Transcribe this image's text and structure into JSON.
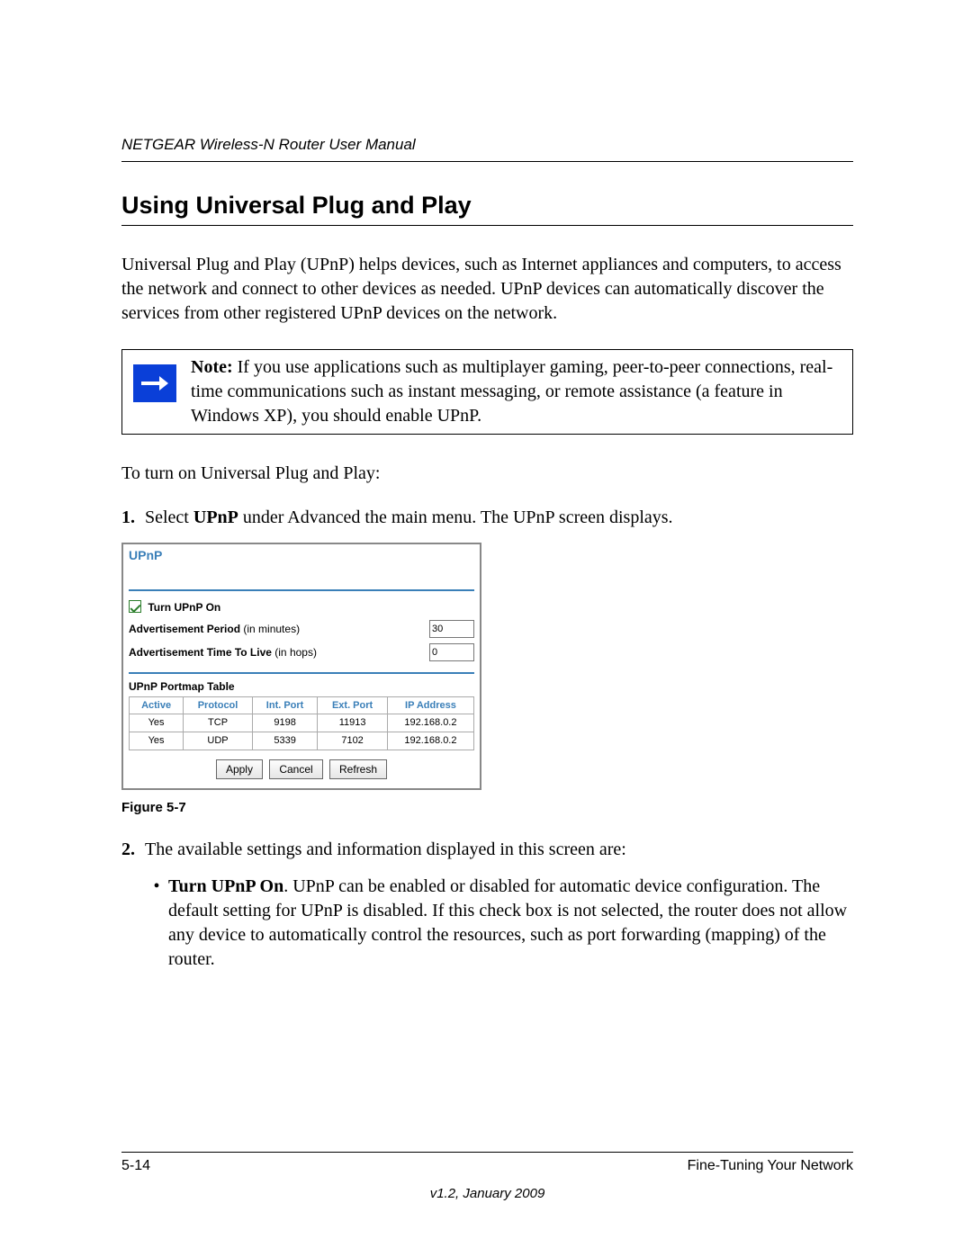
{
  "header": {
    "running_title": "NETGEAR Wireless-N Router User Manual"
  },
  "section": {
    "title": "Using Universal Plug and Play",
    "intro": "Universal Plug and Play (UPnP) helps devices, such as Internet appliances and computers, to access the network and connect to other devices as needed. UPnP devices can automatically discover the services from other registered UPnP devices on the network."
  },
  "note": {
    "label": "Note:",
    "text": " If you use applications such as multiplayer gaming, peer-to-peer connections, real-time communications such as instant messaging, or remote assistance (a feature in Windows XP), you should enable UPnP."
  },
  "steps": {
    "lead_in": "To turn on Universal Plug and Play:",
    "item1_num": "1.",
    "item1_pre": "Select ",
    "item1_bold": "UPnP",
    "item1_post": " under Advanced the main menu. The UPnP screen displays.",
    "item2_num": "2.",
    "item2_text": "The available settings and information displayed in this screen are:",
    "bullet1_bold": "Turn UPnP On",
    "bullet1_text": ". UPnP can be enabled or disabled for automatic device configuration. The default setting for UPnP is disabled. If this check box is not selected, the router does not allow any device to automatically control the resources, such as port forwarding (mapping) of the router.",
    "bullet_dot": "•"
  },
  "figure": {
    "caption": "Figure 5-7"
  },
  "panel": {
    "title": "UPnP",
    "checkbox_label": "Turn UPnP On",
    "adv_period_label": "Advertisement Period",
    "adv_period_hint": " (in minutes)",
    "adv_period_value": "30",
    "adv_ttl_label": "Advertisement Time To Live",
    "adv_ttl_hint": " (in hops)",
    "adv_ttl_value": "0",
    "portmap_title": "UPnP Portmap Table",
    "headers": {
      "active": "Active",
      "protocol": "Protocol",
      "intport": "Int. Port",
      "extport": "Ext. Port",
      "ip": "IP Address"
    },
    "rows": [
      {
        "active": "Yes",
        "protocol": "TCP",
        "intport": "9198",
        "extport": "11913",
        "ip": "192.168.0.2"
      },
      {
        "active": "Yes",
        "protocol": "UDP",
        "intport": "5339",
        "extport": "7102",
        "ip": "192.168.0.2"
      }
    ],
    "buttons": {
      "apply": "Apply",
      "cancel": "Cancel",
      "refresh": "Refresh"
    }
  },
  "footer": {
    "page": "5-14",
    "chapter": "Fine-Tuning Your Network",
    "version": "v1.2, January 2009"
  }
}
